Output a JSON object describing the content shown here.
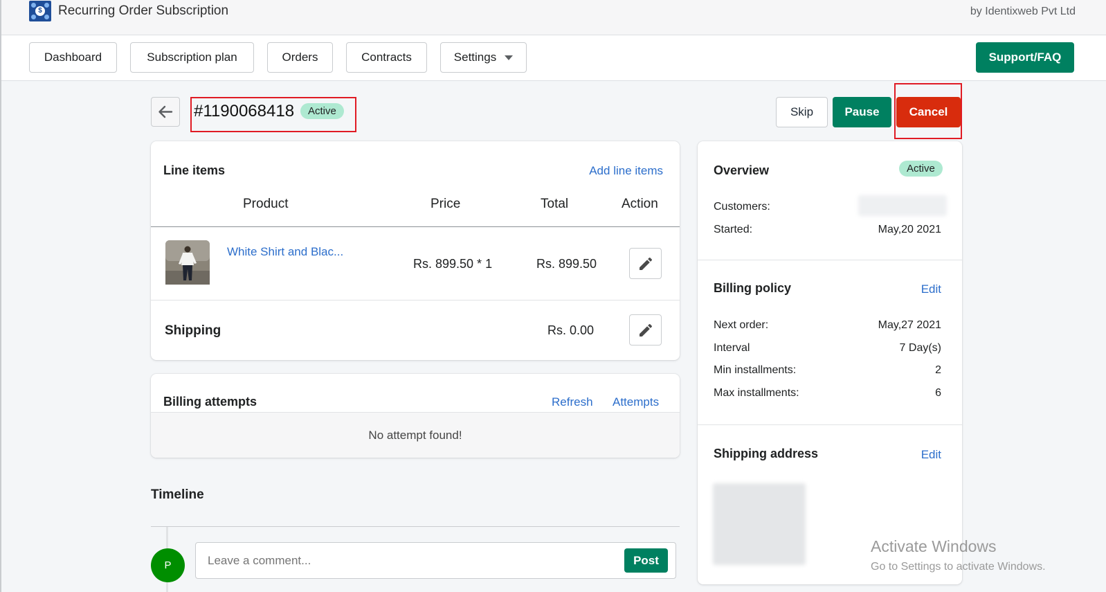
{
  "app": {
    "title": "Recurring Order Subscription",
    "by_line": "by Identixweb Pvt Ltd",
    "logo_icon": "dollar-coin-logo"
  },
  "nav": {
    "items": [
      {
        "label": "Dashboard"
      },
      {
        "label": "Subscription plan"
      },
      {
        "label": "Orders"
      },
      {
        "label": "Contracts"
      },
      {
        "label": "Settings",
        "has_dropdown": true
      }
    ],
    "support_label": "Support/FAQ"
  },
  "contract": {
    "id": "#1190068418",
    "status": "Active",
    "actions": {
      "skip": "Skip",
      "pause": "Pause",
      "cancel": "Cancel"
    }
  },
  "line_items": {
    "title": "Line items",
    "add_link": "Add line items",
    "columns": [
      "Product",
      "Price",
      "Total",
      "Action"
    ],
    "rows": [
      {
        "product": "White Shirt and Blac...",
        "price": "Rs. 899.50 * 1",
        "total": "Rs. 899.50"
      }
    ],
    "shipping_label": "Shipping",
    "shipping_value": "Rs. 0.00"
  },
  "billing_attempts": {
    "title": "Billing attempts",
    "refresh": "Refresh",
    "attempts": "Attempts",
    "empty": "No attempt found!"
  },
  "timeline": {
    "title": "Timeline",
    "avatar_initial": "P",
    "comment_placeholder": "Leave a comment...",
    "post_label": "Post"
  },
  "overview": {
    "title": "Overview",
    "status": "Active",
    "customers_label": "Customers:",
    "started_label": "Started:",
    "started_value": "May,20 2021"
  },
  "billing_policy": {
    "title": "Billing policy",
    "edit": "Edit",
    "rows": [
      {
        "label": "Next order:",
        "value": "May,27 2021"
      },
      {
        "label": "Interval",
        "value": "7 Day(s)"
      },
      {
        "label": "Min installments:",
        "value": "2"
      },
      {
        "label": "Max installments:",
        "value": "6"
      }
    ]
  },
  "shipping_address": {
    "title": "Shipping address",
    "edit": "Edit"
  },
  "watermark": {
    "line1": "Activate Windows",
    "line2": "Go to Settings to activate Windows."
  },
  "colors": {
    "primary_green": "#008060",
    "cancel_red": "#d82c0d",
    "highlight_red": "#e01b24",
    "link_blue": "#2c6ecb",
    "status_pill": "#aee9d1"
  }
}
